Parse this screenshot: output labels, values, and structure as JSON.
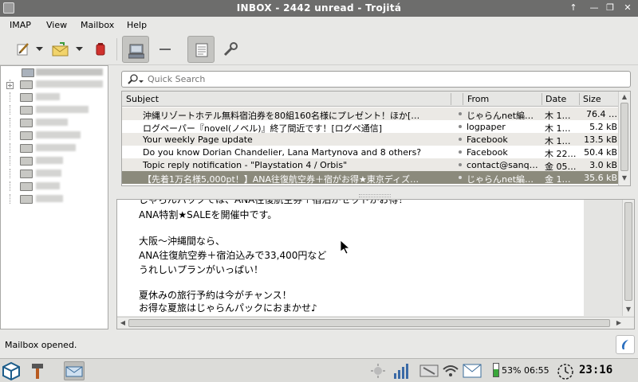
{
  "window": {
    "title": "INBOX - 2442 unread - Trojitá",
    "buttons": [
      "↑",
      "—",
      "❐",
      "✕"
    ]
  },
  "menu": {
    "items": [
      "IMAP",
      "View",
      "Mailbox",
      "Help"
    ]
  },
  "toolbar": {
    "buttons": [
      "compose-icon",
      "reply-icon",
      "delete-icon",
      "network-icon",
      "collapse-icon",
      "view-icon",
      "settings-icon"
    ]
  },
  "search": {
    "placeholder": "Quick Search"
  },
  "message_list": {
    "columns": [
      "Subject",
      "From",
      "Date",
      "Size"
    ],
    "rows": [
      {
        "subject": "沖縄リゾートホテル無料宿泊券を80組160名様にプレゼント！ほか[…",
        "from": "じゃらんnet編…",
        "date": "木 1…",
        "size": "76.4 …"
      },
      {
        "subject": "ログペーパー『novel(ノベル)』終了間近です！[ログペ通信]",
        "from": "logpaper",
        "date": "木 1…",
        "size": "5.2 kB"
      },
      {
        "subject": "Your weekly Page update",
        "from": "Facebook",
        "date": "木 1…",
        "size": "13.5 kB"
      },
      {
        "subject": "Do you know Dorian Chandelier, Lana Martynova and 8 others?",
        "from": "Facebook",
        "date": "木 22…",
        "size": "50.4 kB"
      },
      {
        "subject": "Topic reply notification - \"Playstation 4 / Orbis\"",
        "from": "contact@sanq…",
        "date": "金 05…",
        "size": "3.0 kB"
      },
      {
        "subject": "【先着1万名様5,000pt！】ANA往復航空券＋宿がお得★東京ディズ…",
        "from": "じゃらんnet編…",
        "date": "金 1…",
        "size": "35.6 kB"
      }
    ]
  },
  "message_body": {
    "lines": [
      "じゃらんパックでは、ANA往復航空券＋宿泊がセットがお得！",
      "ANA特割★SALEを開催中です。",
      "",
      "大阪～沖縄間なら、",
      "ANA往復航空券＋宿泊込みで33,400円など",
      "うれしいプランがいっぱい！",
      "",
      "夏休みの旅行予約は今がチャンス！",
      "お得な夏旅はじゃらんパックにおまかせ♪"
    ]
  },
  "status": {
    "text": "Mailbox opened."
  },
  "taskbar": {
    "battery": "53% 06:55",
    "clock": "23:16"
  }
}
